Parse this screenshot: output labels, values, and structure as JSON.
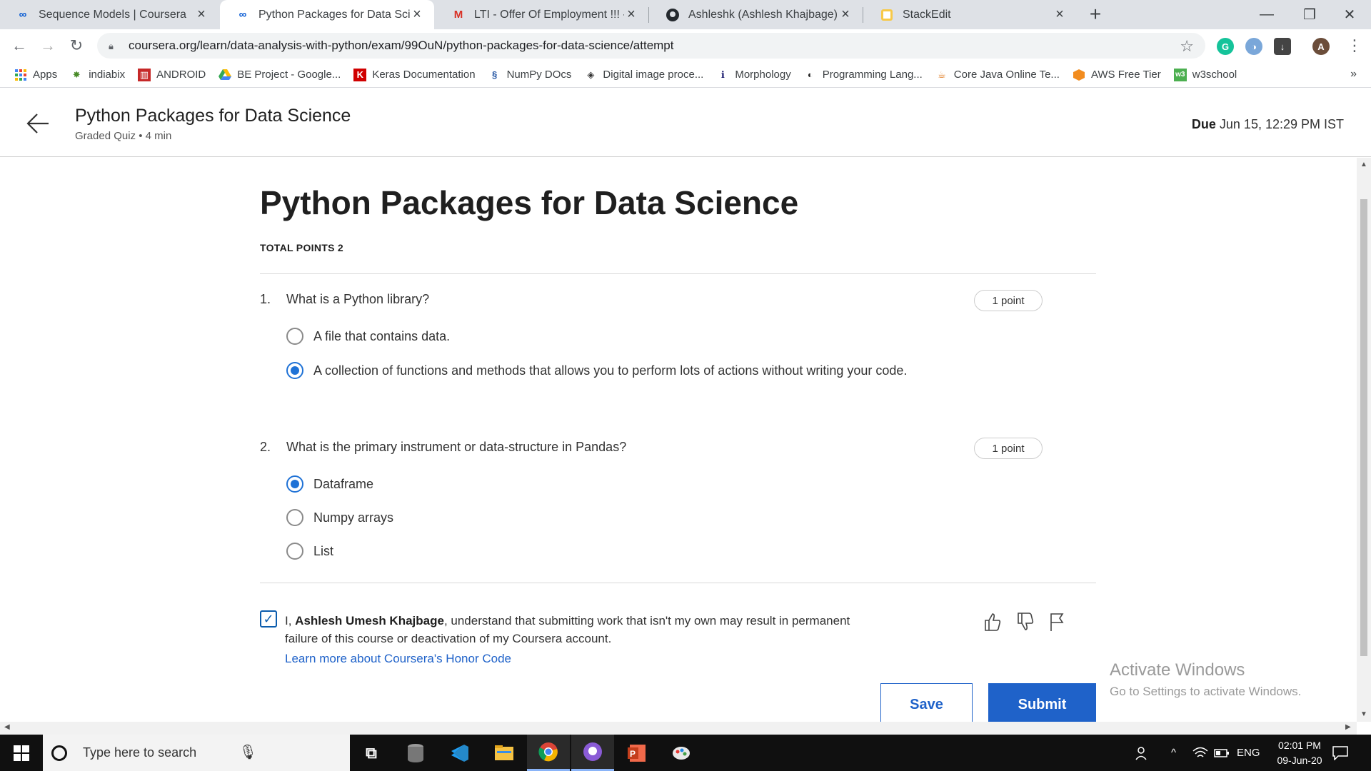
{
  "browser": {
    "tabs": [
      {
        "title": "Sequence Models | Coursera",
        "active": false
      },
      {
        "title": "Python Packages for Data Science",
        "active": true
      },
      {
        "title": "LTI - Offer Of Employment !!! - as",
        "active": false
      },
      {
        "title": "Ashleshk (Ashlesh Khajbage)",
        "active": false
      },
      {
        "title": "StackEdit",
        "active": false
      }
    ],
    "url": "coursera.org/learn/data-analysis-with-python/exam/99OuN/python-packages-for-data-science/attempt",
    "bookmarks": [
      "Apps",
      "indiabix",
      "ANDROID",
      "BE Project - Google...",
      "Keras Documentation",
      "NumPy DOcs",
      "Digital image proce...",
      "Morphology",
      "Programming Lang...",
      "Core Java Online Te...",
      "AWS Free Tier",
      "w3school"
    ],
    "bookmarks_more": "»"
  },
  "header": {
    "title": "Python Packages for Data Science",
    "subtitle": "Graded Quiz • 4 min",
    "due_label": "Due",
    "due_value": "Jun 15, 12:29 PM IST"
  },
  "quiz": {
    "title": "Python Packages for Data Science",
    "total_points": "TOTAL POINTS 2",
    "questions": [
      {
        "number": "1.",
        "text": "What is a Python library?",
        "points": "1 point",
        "options": [
          {
            "label": "A file that contains data.",
            "selected": false
          },
          {
            "label": "A collection of functions and methods that allows you to perform lots of actions without writing your code.",
            "selected": true
          }
        ]
      },
      {
        "number": "2.",
        "text": "What is the primary instrument or data-structure in Pandas?",
        "points": "1 point",
        "options": [
          {
            "label": "Dataframe",
            "selected": true
          },
          {
            "label": "Numpy arrays",
            "selected": false
          },
          {
            "label": "List",
            "selected": false
          }
        ]
      }
    ],
    "honor": {
      "checked": true,
      "prefix": "I, ",
      "name": "Ashlesh Umesh Khajbage",
      "suffix": ", understand that submitting work that isn't my own may result in permanent failure of this course or deactivation of my Coursera account.",
      "link": "Learn more about Coursera's Honor Code"
    },
    "save_label": "Save",
    "submit_label": "Submit"
  },
  "watermark": {
    "line1": "Activate Windows",
    "line2": "Go to Settings to activate Windows."
  },
  "taskbar": {
    "search_placeholder": "Type here to search",
    "language": "ENG",
    "time": "02:01 PM",
    "date": "09-Jun-20"
  },
  "colors": {
    "accent": "#1f62c9",
    "radio_selected": "#1f72d6",
    "tabstrip": "#dee1e6"
  }
}
